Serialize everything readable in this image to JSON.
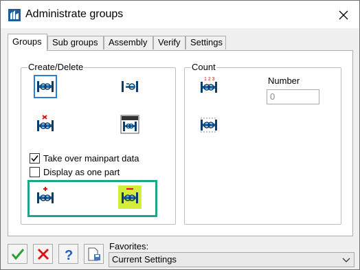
{
  "window": {
    "title": "Administrate groups"
  },
  "tabs": [
    {
      "label": "Groups",
      "active": true
    },
    {
      "label": "Sub groups",
      "active": false
    },
    {
      "label": "Assembly",
      "active": false
    },
    {
      "label": "Verify",
      "active": false
    },
    {
      "label": "Settings",
      "active": false
    }
  ],
  "create_delete": {
    "label": "Create/Delete",
    "icons": [
      "create-group-icon",
      "add-to-group-icon",
      "delete-group-icon",
      "group-properties-icon",
      "add-mainpart-icon",
      "remove-mainpart-icon"
    ],
    "checkboxes": [
      {
        "label": "Take over mainpart data",
        "checked": true
      },
      {
        "label": "Display as one part",
        "checked": false
      }
    ]
  },
  "count": {
    "label": "Count",
    "number_label": "Number",
    "number_value": "0",
    "icons": [
      "count-groups-icon",
      "count-parts-icon"
    ]
  },
  "footer": {
    "favorites_label": "Favorites:",
    "favorites_value": "Current Settings"
  },
  "colors": {
    "accent": "#1aa68a",
    "highlight": "#d4ec3c",
    "selection": "#2a7fd4"
  }
}
